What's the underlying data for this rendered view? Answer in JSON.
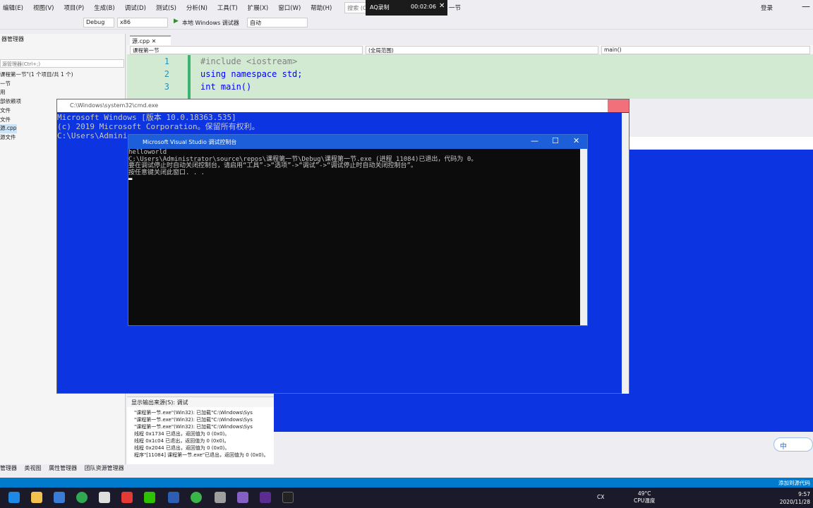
{
  "menubar": {
    "items": [
      "编辑(E)",
      "视图(V)",
      "项目(P)",
      "生成(B)",
      "调试(D)",
      "测试(S)",
      "分析(N)",
      "工具(T)",
      "扩展(X)",
      "窗口(W)",
      "帮助(H)"
    ],
    "search_placeholder": "搜索 (Ctrl+Q)",
    "login": "登录"
  },
  "recorder": {
    "name": "AQ录制",
    "time": "00:02:06",
    "suffix": "一节"
  },
  "toolbar": {
    "config": "Debug",
    "platform": "x86",
    "run_label": "本地 Windows 调试器",
    "run_mode": "自动"
  },
  "left_panel": {
    "header": "器管理器",
    "search_placeholder": "源管理器(Ctrl+;)",
    "items": [
      "课程第一节\"(1 个项目/共 1 个)",
      "一节",
      "用",
      "部依赖项",
      "文件",
      "文件",
      "源.cpp",
      "源文件"
    ]
  },
  "editor": {
    "tab": "源.cpp",
    "nav_project": "课程第一节",
    "nav_scope": "(全局范围)",
    "nav_func": "main()",
    "line_numbers": [
      "1",
      "2",
      "3"
    ],
    "lines": [
      "#include <iostream>",
      "using namespace std;",
      "int main()"
    ]
  },
  "cmd": {
    "title": "C:\\Windows\\system32\\cmd.exe",
    "lines": [
      "Microsoft Windows [版本 10.0.18363.535]",
      "(c) 2019 Microsoft Corporation。保留所有权利。",
      "",
      "C:\\Users\\Admini"
    ]
  },
  "vsconsole": {
    "title": "Microsoft Visual Studio 调试控制台",
    "lines": [
      "helloworld",
      "",
      "C:\\Users\\Administrator\\source\\repos\\课程第一节\\Debug\\课程第一节.exe (进程 11084)已退出，代码为 0。",
      "要在调试停止时自动关闭控制台，请启用“工具”->“选项”->“调试”->“调试停止时自动关闭控制台”。",
      "按任意键关闭此窗口. . ."
    ]
  },
  "output": {
    "label": "显示输出来源(S):",
    "source": "调试",
    "lines": [
      "\"课程第一节.exe\"(Win32): 已加载\"C:\\Windows\\Sys",
      "\"课程第一节.exe\"(Win32): 已加载\"C:\\Windows\\Sys",
      "\"课程第一节.exe\"(Win32): 已加载\"C:\\Windows\\Sys",
      "线程 0x1734 已退出，返回值为 0 (0x0)。",
      "线程 0x1c04 已退出，返回值为 0 (0x0)。",
      "线程 0x2044 已退出，返回值为 0 (0x0)。",
      "程序\"[11084] 课程第一节.exe\"已退出，返回值为 0 (0x0)。"
    ]
  },
  "bottom_tabs": [
    "管理器",
    "类视图",
    "属性管理器",
    "团队资源管理器"
  ],
  "statusbar": {
    "right": "添加到源代码"
  },
  "ime": {
    "text": "中"
  },
  "taskbar": {
    "temp": "49°C",
    "temp_label": "CPU温度",
    "time": "9:57",
    "date": "2020/11/28",
    "ime_tag": "CX"
  },
  "colors": {
    "cmd_bg": "#0c34e0",
    "console_bg": "#0c0c0c",
    "status": "#007acc",
    "editor_bg": "#d2ead2"
  }
}
